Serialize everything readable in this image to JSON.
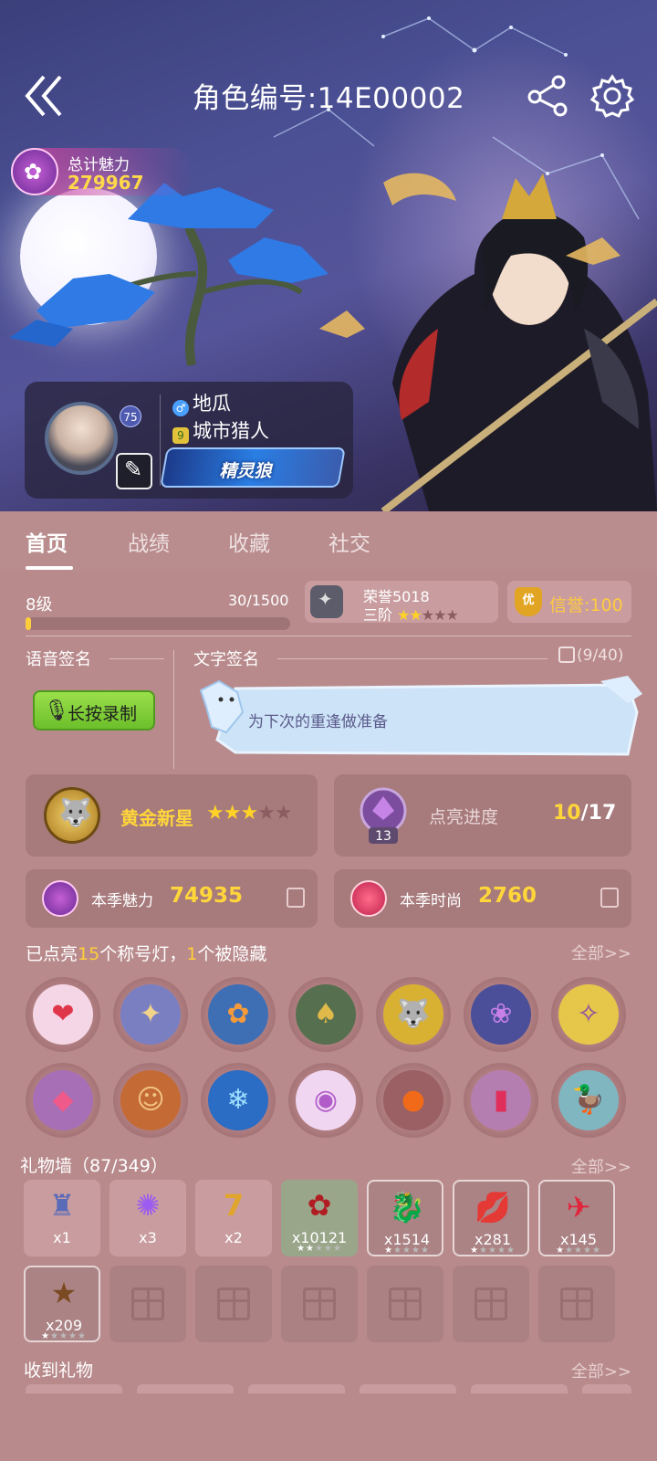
{
  "header": {
    "title": "角色编号:14E00002",
    "back_icon": "double-chevron-left-icon",
    "share_icon": "share-icon",
    "settings_icon": "gear-icon"
  },
  "charm_total": {
    "label": "总计魅力",
    "value": "279967"
  },
  "profile": {
    "level_badge": "75",
    "gender_icon": "male-icon",
    "name": "地瓜",
    "title": "城市猎人",
    "banner_text": "精灵狼"
  },
  "tabs": [
    {
      "label": "首页",
      "active": true
    },
    {
      "label": "战绩",
      "active": false
    },
    {
      "label": "收藏",
      "active": false
    },
    {
      "label": "社交",
      "active": false
    }
  ],
  "level": {
    "label": "8级",
    "exp": "30/1500",
    "progress": 0.02
  },
  "honor": {
    "label": "荣誉5018",
    "tier": "三阶",
    "stars_on": 2,
    "stars_total": 5
  },
  "credit": {
    "icon_text": "优",
    "label": "信誉:100"
  },
  "voice_sign": {
    "title": "语音签名",
    "record_label": "长按录制"
  },
  "text_sign": {
    "title": "文字签名",
    "count": "(9/40)",
    "text": "为下次的重逢做准备"
  },
  "medal": {
    "name": "黄金新星",
    "stars_on": 3,
    "stars_total": 5
  },
  "light_progress": {
    "badge_num": "13",
    "label": "点亮进度",
    "current": "10",
    "total": "/17"
  },
  "season": {
    "charm_label": "本季魅力",
    "charm_value": "74935",
    "fashion_label": "本季时尚",
    "fashion_value": "2760"
  },
  "titles": {
    "head_prefix": "已点亮",
    "lit": "15",
    "head_mid": "个称号灯，",
    "hidden": "1",
    "head_suffix": "个被隐藏",
    "all_link": "全部>>"
  },
  "gift_wall": {
    "title": "礼物墙（87/349）",
    "all_link": "全部>>",
    "items": [
      {
        "icon": "castle-icon",
        "count": "x1"
      },
      {
        "icon": "magic-orb-icon",
        "count": "x3"
      },
      {
        "icon": "lucky-seven-icon",
        "count": "x2"
      },
      {
        "icon": "rose-icon",
        "count": "x10121",
        "stars": 2
      },
      {
        "icon": "firecracker-icon",
        "count": "x1514",
        "stars": 1
      },
      {
        "icon": "lips-icon",
        "count": "x281",
        "stars": 1
      },
      {
        "icon": "paper-crane-icon",
        "count": "x145",
        "stars": 1
      },
      {
        "icon": "starfish-icon",
        "count": "x209",
        "stars": 1
      }
    ]
  },
  "received": {
    "title": "收到礼物",
    "all_link": "全部>>"
  }
}
